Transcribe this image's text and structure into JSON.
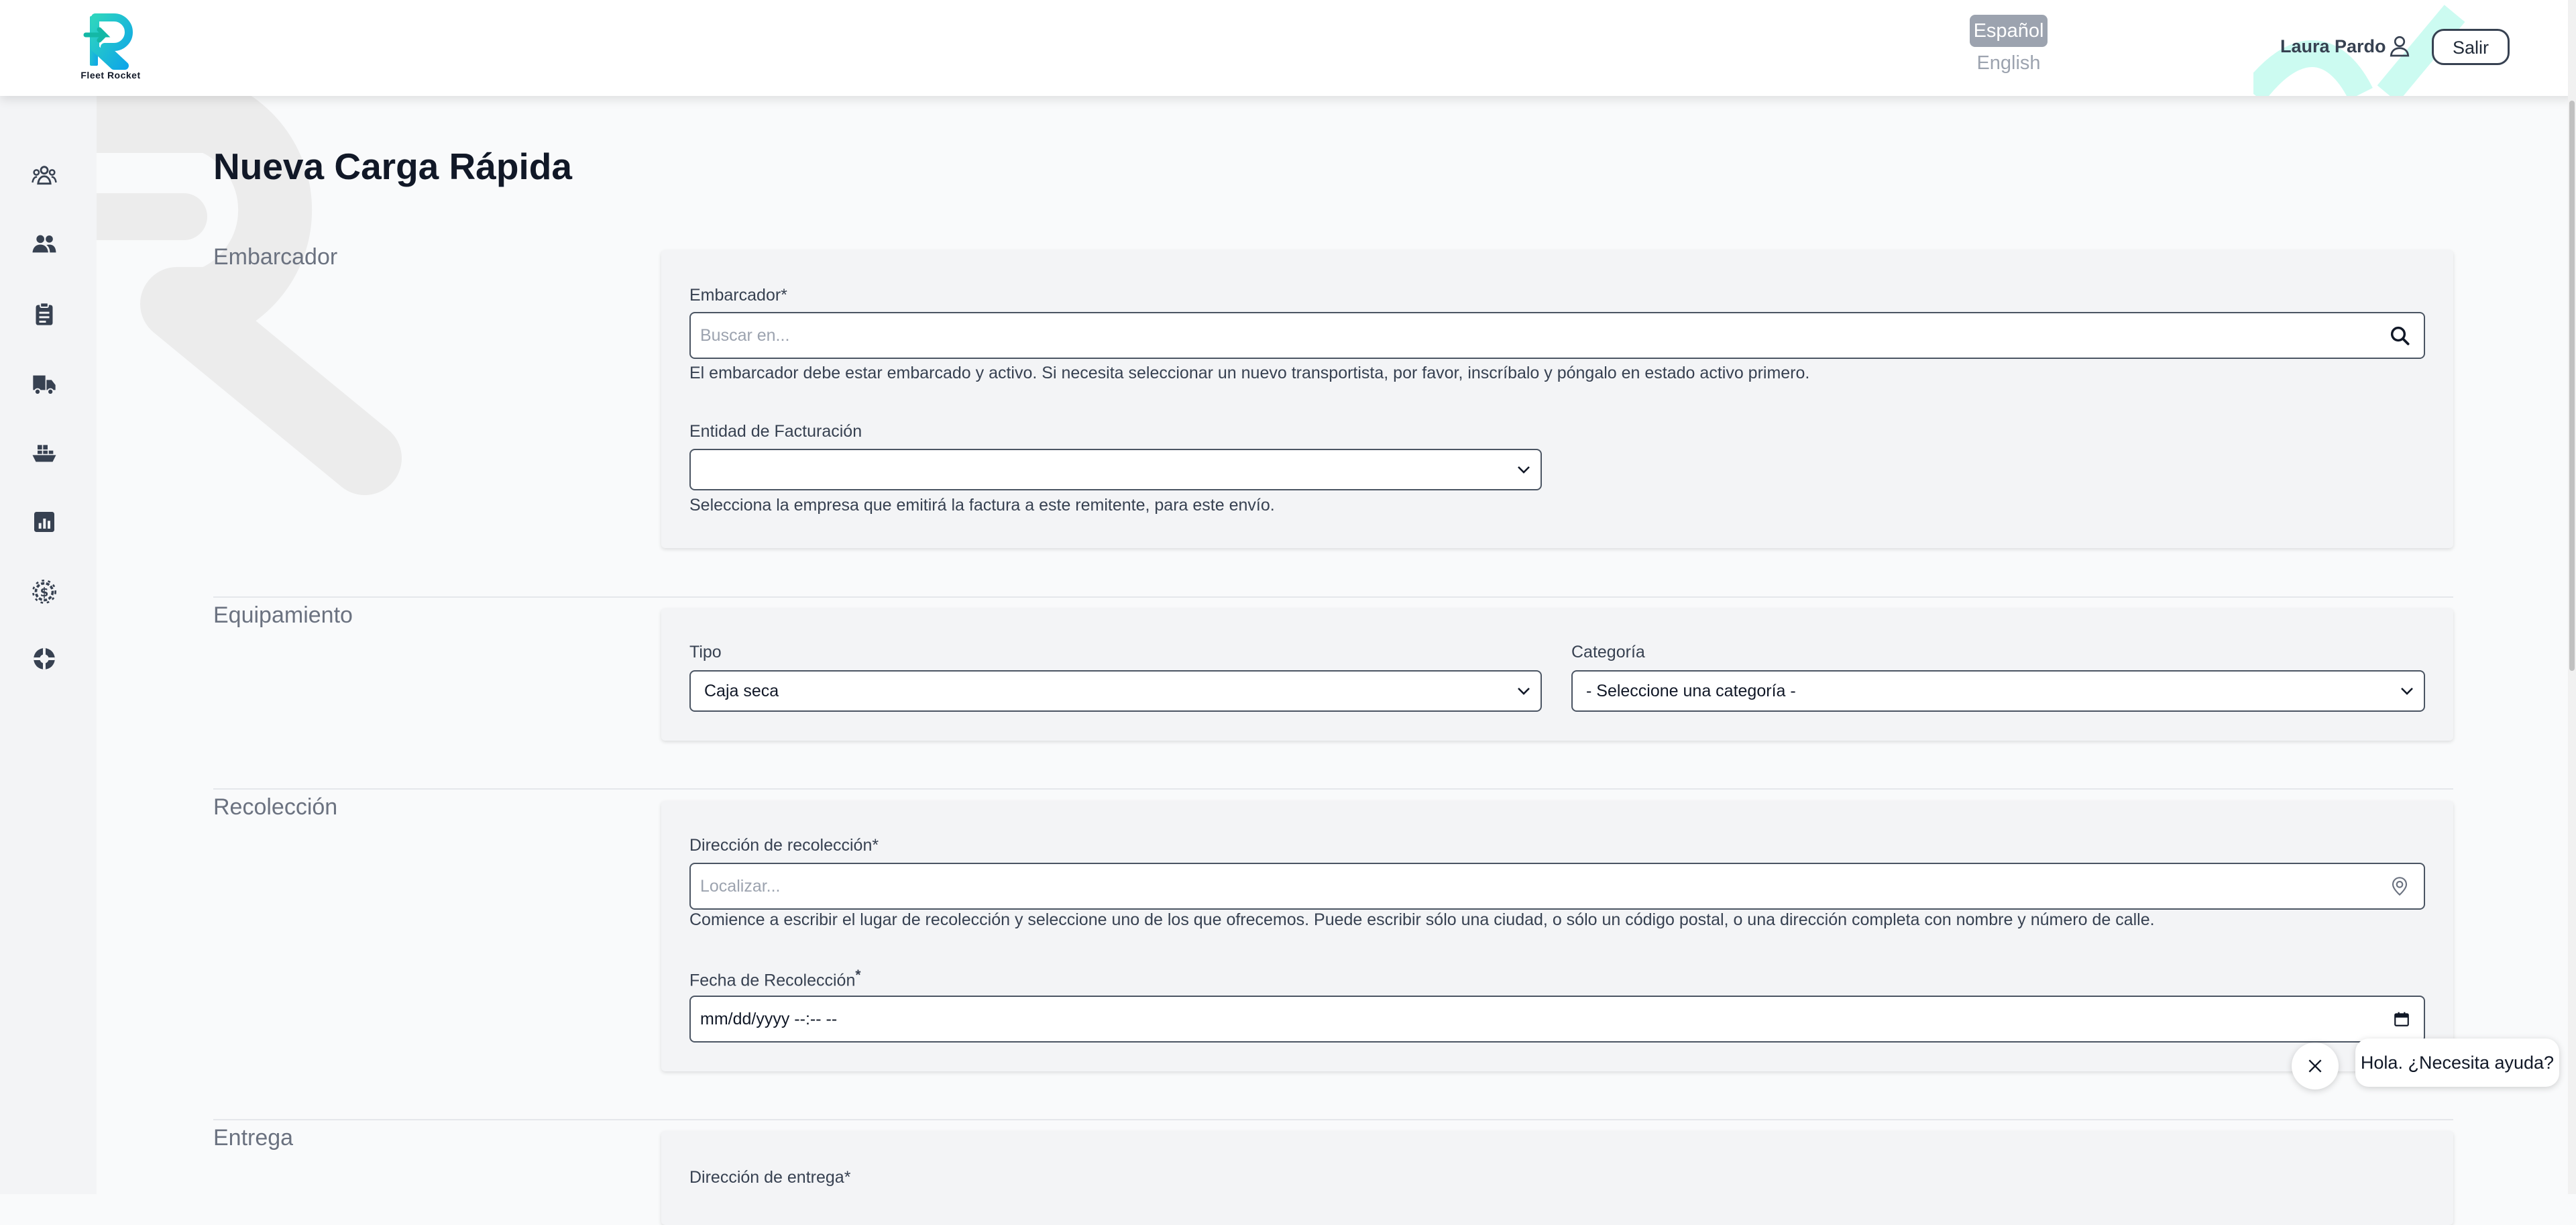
{
  "header": {
    "brand": "Fleet Rocket",
    "lang_active": "Español",
    "lang_other": "English",
    "user_name": "Laura Pardo",
    "logout_label": "Salir"
  },
  "sidebar": {
    "items": [
      {
        "icon": "users-group-icon"
      },
      {
        "icon": "users-icon"
      },
      {
        "icon": "clipboard-icon"
      },
      {
        "icon": "truck-icon"
      },
      {
        "icon": "ship-icon"
      },
      {
        "icon": "chart-icon"
      },
      {
        "icon": "money-gear-icon"
      },
      {
        "icon": "support-icon"
      }
    ]
  },
  "page": {
    "title": "Nueva Carga Rápida"
  },
  "embarcador": {
    "section": "Embarcador",
    "field_label": "Embarcador*",
    "placeholder": "Buscar en...",
    "help": "El embarcador debe estar embarcado y activo. Si necesita seleccionar un nuevo transportista, por favor, inscríbalo y póngalo en estado activo primero.",
    "billing_label": "Entidad de Facturación",
    "billing_value": "",
    "billing_help": "Selecciona la empresa que emitirá la factura a este remitente, para este envío."
  },
  "equipamiento": {
    "section": "Equipamiento",
    "type_label": "Tipo",
    "type_value": "Caja seca",
    "category_label": "Categoría",
    "category_value": "- Seleccione una categoría -"
  },
  "recoleccion": {
    "section": "Recolección",
    "address_label": "Dirección de recolección*",
    "address_placeholder": "Localizar...",
    "address_help": "Comience a escribir el lugar de recolección y seleccione uno de los que ofrecemos. Puede escribir sólo una ciudad, o sólo un código postal, o una dirección completa con nombre y número de calle.",
    "date_label": "Fecha de Recolección",
    "date_required": "*",
    "date_value": "mm/dd/yyyy --:-- --"
  },
  "entrega": {
    "section": "Entrega",
    "address_label": "Dirección de entrega*"
  },
  "chat": {
    "message": "Hola. ¿Necesita ayuda?"
  }
}
